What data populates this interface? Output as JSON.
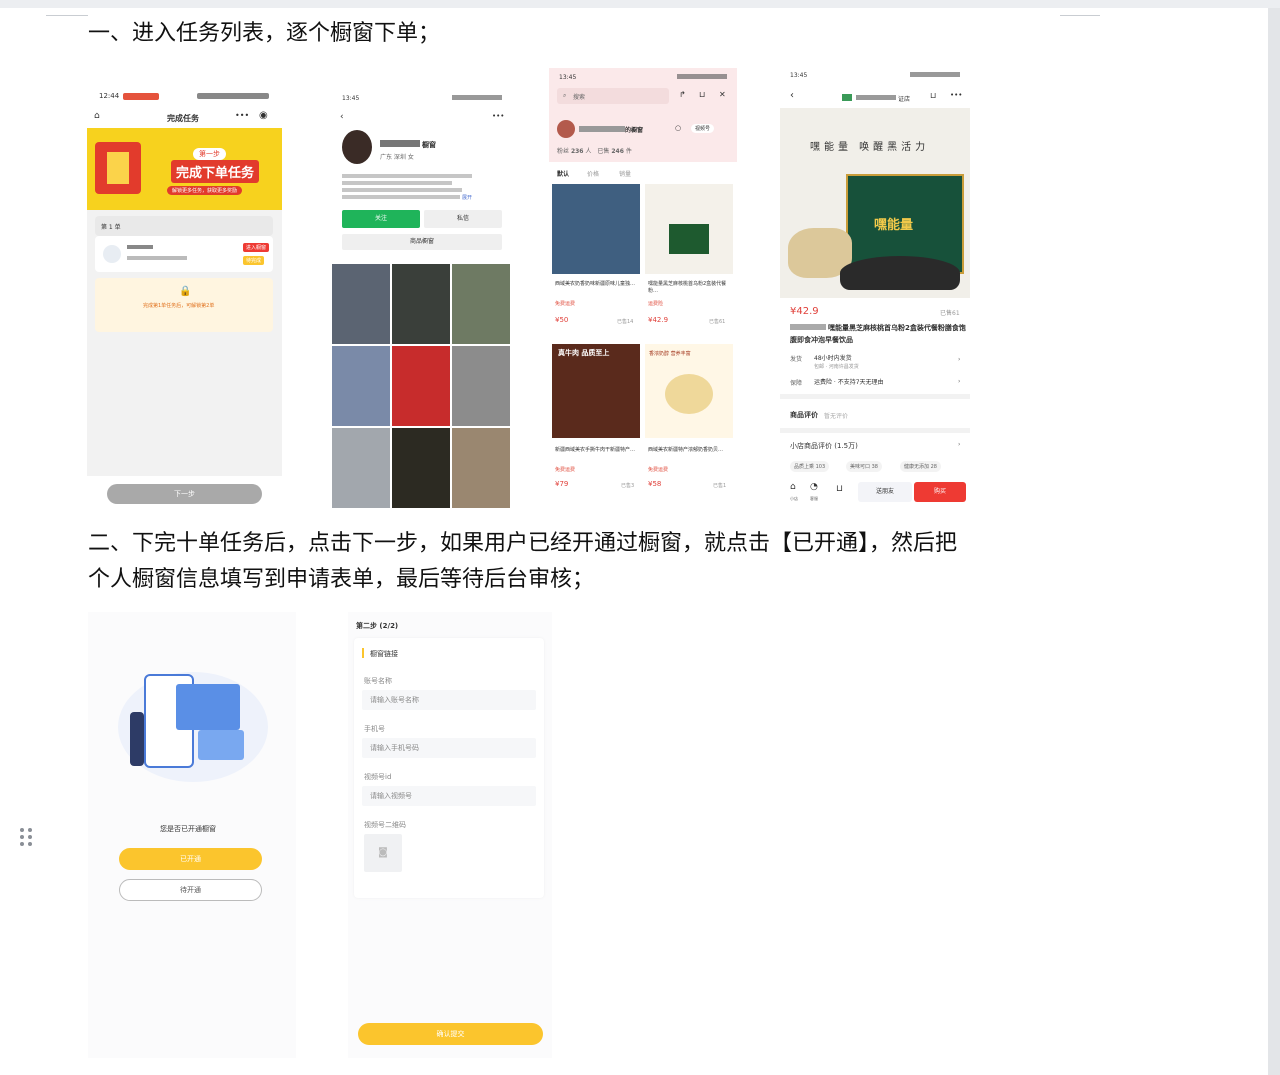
{
  "doc": {
    "step1": "一、进入任务列表，逐个橱窗下单；",
    "step2_line1": "二、下完十单任务后，点击下一步，如果用户已经开通过橱窗，就点击【已开通】，然后把",
    "step2_line2": "个人橱窗信息填写到申请表单，最后等待后台审核；"
  },
  "shot1": {
    "time": "12:44",
    "title": "完成任务",
    "banner_badge": "第一步",
    "banner_title": "完成下单任务",
    "banner_sub": "解锁更多任务，获取更多奖励",
    "order_label": "第 1 单",
    "btn_enter": "进入橱窗",
    "btn_wait": "待完成",
    "lock_text": "完成第1单任务后，可解锁第2单",
    "next": "下一步"
  },
  "shot2": {
    "time": "13:45",
    "location": "广东 深圳 女",
    "shop_name": "橱窗",
    "follow": "关注",
    "message": "私信",
    "window_btn": "商品橱窗",
    "more": "展开"
  },
  "shot3": {
    "time": "13:45",
    "search": "搜索",
    "shop": "的橱窗",
    "follow_btn": "视频号",
    "stats_fans_label": "粉丝",
    "stats_fans": "236",
    "stats_fans_unit": "人",
    "stats_sold_label": "已售",
    "stats_sold": "246",
    "stats_sold_unit": "件",
    "tabs": [
      "默认",
      "价格",
      "销量"
    ],
    "items": [
      {
        "title": "西域美农奶香奶味新疆原味儿童独…",
        "tag": "免费运费",
        "price": "¥50",
        "sold": "已售14"
      },
      {
        "title": "嘿能量黑芝麻核桃首乌粉2盒装代餐粉…",
        "tag": "运费险",
        "price": "¥42.9",
        "sold": "已售61"
      },
      {
        "title": "新疆西域美农手撕牛肉干新疆特产…",
        "tag": "免费运费",
        "price": "¥79",
        "sold": "已售3"
      },
      {
        "title": "西域美农新疆特产浓郁奶香奶贝…",
        "tag": "免费运费",
        "price": "¥58",
        "sold": "已售1"
      }
    ],
    "banner_beef": "真牛肉 品质至上",
    "banner_milk": "香浓奶醇 营养丰富"
  },
  "shot4": {
    "time": "13:45",
    "store": "证店",
    "brand": "嘿能量",
    "slogan": "嘿能量 唤醒黑活力",
    "price": "¥42.9",
    "sold": "已售61",
    "title": "嘿能量黑芝麻核桃首乌粉2盒装代餐粉膳食饱腹即食冲泡早餐饮品",
    "ship_label": "发货",
    "ship_value": "48小时内发货",
    "ship_sub": "包邮 · 河南许昌发货",
    "guarantee_label": "保障",
    "guarantee_value": "运费险 · 不支持7天无理由",
    "review_label": "商品评价",
    "review_empty": "暂无评价",
    "shop_review": "小店商品评价 (1.5万)",
    "review_tags": [
      "品质上乘 103",
      "美味可口 38",
      "健康无添加 28"
    ],
    "btn_share": "送朋友",
    "btn_buy": "购买",
    "icon_shop": "小店",
    "icon_service": "客服"
  },
  "shot5": {
    "question": "您是否已开通橱窗",
    "btn_yes": "已开通",
    "btn_no": "待开通"
  },
  "shot6": {
    "step": "第二步 (2/2)",
    "section": "橱窗链接",
    "field1_label": "账号名称",
    "field1_placeholder": "请输入账号名称",
    "field2_label": "手机号",
    "field2_placeholder": "请输入手机号码",
    "field3_label": "视频号id",
    "field3_placeholder": "请输入视频号",
    "field4_label": "视频号二维码",
    "submit": "确认提交"
  },
  "colors": {
    "yellow": "#fbc52d",
    "red": "#ee3a33",
    "green": "#1fb45a",
    "pink": "#fbe9ea"
  }
}
